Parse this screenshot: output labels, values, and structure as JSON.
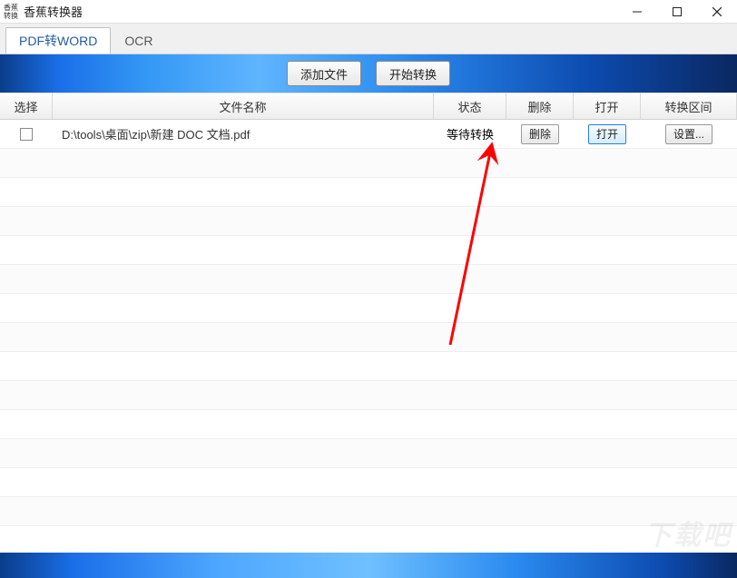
{
  "window": {
    "icon_text_top": "香蕉",
    "icon_text_bottom": "转换",
    "title": "香蕉转换器"
  },
  "tabs": [
    {
      "label": "PDF转WORD",
      "active": true
    },
    {
      "label": "OCR",
      "active": false
    }
  ],
  "toolbar": {
    "add_file": "添加文件",
    "start_convert": "开始转换"
  },
  "table": {
    "headers": {
      "select": "选择",
      "name": "文件名称",
      "status": "状态",
      "delete": "删除",
      "open": "打开",
      "range": "转换区间"
    },
    "rows": [
      {
        "checked": false,
        "name": "D:\\tools\\桌面\\zip\\新建 DOC 文档.pdf",
        "status": "等待转换",
        "delete_label": "删除",
        "open_label": "打开",
        "range_label": "设置..."
      }
    ]
  },
  "watermark": "下载吧"
}
